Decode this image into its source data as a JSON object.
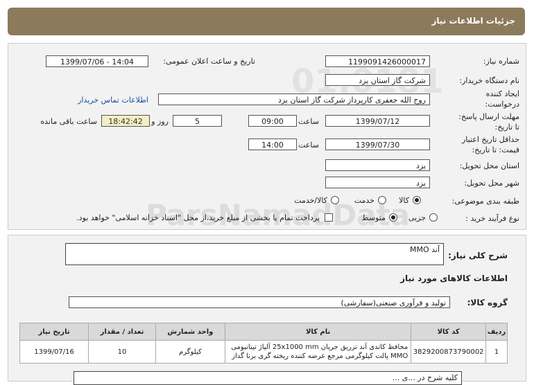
{
  "title": "جزئیات اطلاعات نیاز",
  "form": {
    "need_number_label": "شماره نیاز:",
    "need_number": "1199091426000017",
    "announce_label": "تاریخ و ساعت اعلان عمومی:",
    "announce_value": "1399/07/06 - 14:04",
    "buyer_label": "نام دستگاه خریدار:",
    "buyer": "شرکت گاز استان یزد",
    "creator_label_1": "ایجاد کننده",
    "creator_label_2": "درخواست:",
    "creator": "روح الله جعفری کارپرداز  شرکت گاز استان یزد",
    "contact_link": "اطلاعات تماس خریدار",
    "deadline_label_1": "مهلت ارسال پاسخ:",
    "deadline_label_2": "تا تاریخ:",
    "deadline_date": "1399/07/12",
    "time_label": "ساعت",
    "deadline_time": "09:00",
    "days_value": "5",
    "days_label": "روز و",
    "remaining_time": "18:42:42",
    "remaining_label": "ساعت باقی مانده",
    "validity_label_1": "حداقل تاریخ اعتبار",
    "validity_label_2": "قیمت: تا تاریخ:",
    "validity_date": "1399/07/30",
    "validity_time": "14:00",
    "province_label": "استان محل تحویل:",
    "province": "یزد",
    "city_label": "شهر محل تحویل:",
    "city": "یزد",
    "category_label": "طبقه بندی موضوعی:",
    "category_options": [
      "کالا",
      "خدمت",
      "کالا/خدمت"
    ],
    "process_label": "نوع فرآیند خرید :",
    "process_options": [
      "جزیی",
      "متوسط"
    ],
    "payment_note": "پرداخت تمام یا بخشی از مبلغ خرید،از محل \"اسناد خزانه اسلامی\" خواهد بود."
  },
  "details": {
    "description_label": "شرح کلی نیاز:",
    "description": "آند MMO",
    "goods_info_title": "اطلاعات کالاهای مورد نیاز",
    "group_label": "گروه کالا:",
    "group_value": "تولید و فرآوری صنعتی(سفارشی)",
    "table_headers": [
      "ردیف",
      "کد کالا",
      "نام کالا",
      "واحد شمارش",
      "تعداد / مقدار",
      "تاریخ نیاز"
    ],
    "rows": [
      {
        "row": "1",
        "code": "3829200873790002",
        "name_line1": "محافظ کاتدی آند تزریق جریان 25x1000 mm آلیاژ تیتانیومی",
        "name_line2": "MMO پالت کیلوگرمی مرجع عرضه کننده ریخته گری برنا گداز",
        "unit": "کیلوگرم",
        "qty": "10",
        "date": "1399/07/16"
      }
    ],
    "notes_partial": "کلیه شرح در ...ی ..."
  }
}
